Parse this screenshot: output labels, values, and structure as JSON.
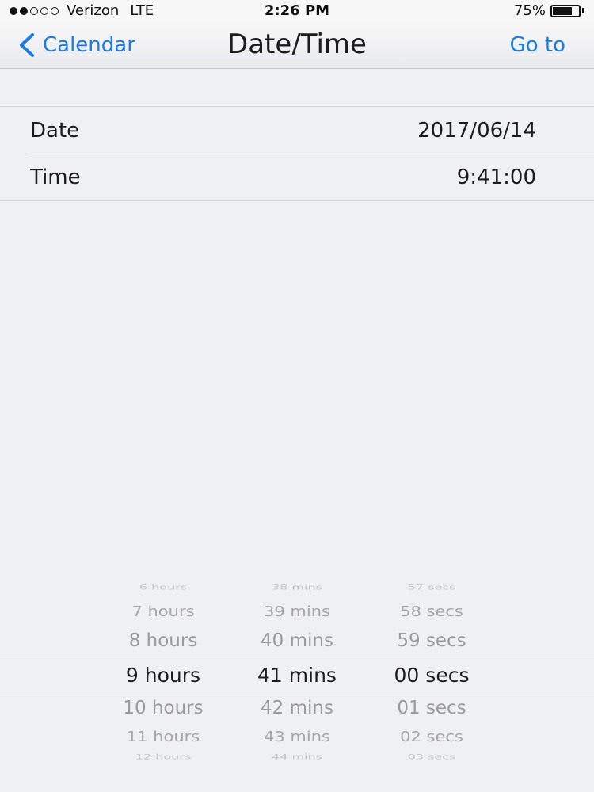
{
  "status_bar": {
    "carrier": "Verizon",
    "network": "LTE",
    "time": "2:26 PM",
    "battery_percent": "75%",
    "battery_level": 0.75
  },
  "nav": {
    "back_label": "Calendar",
    "title": "Date/Time",
    "action_label": "Go to"
  },
  "table": {
    "rows": [
      {
        "label": "Date",
        "value": "2017/06/14"
      },
      {
        "label": "Time",
        "value": "9:41:00"
      }
    ]
  },
  "picker": {
    "hours": [
      "6 hours",
      "7 hours",
      "8 hours",
      "9 hours",
      "10 hours",
      "11 hours",
      "12 hours"
    ],
    "minutes": [
      "38 mins",
      "39 mins",
      "40 mins",
      "41 mins",
      "42 mins",
      "43 mins",
      "44 mins"
    ],
    "seconds": [
      "57 secs",
      "58 secs",
      "59 secs",
      "00 secs",
      "01 secs",
      "02 secs",
      "03 secs"
    ],
    "selected_index": 3
  },
  "colors": {
    "accent": "#1d7ce0",
    "background": "#eff0f4"
  }
}
